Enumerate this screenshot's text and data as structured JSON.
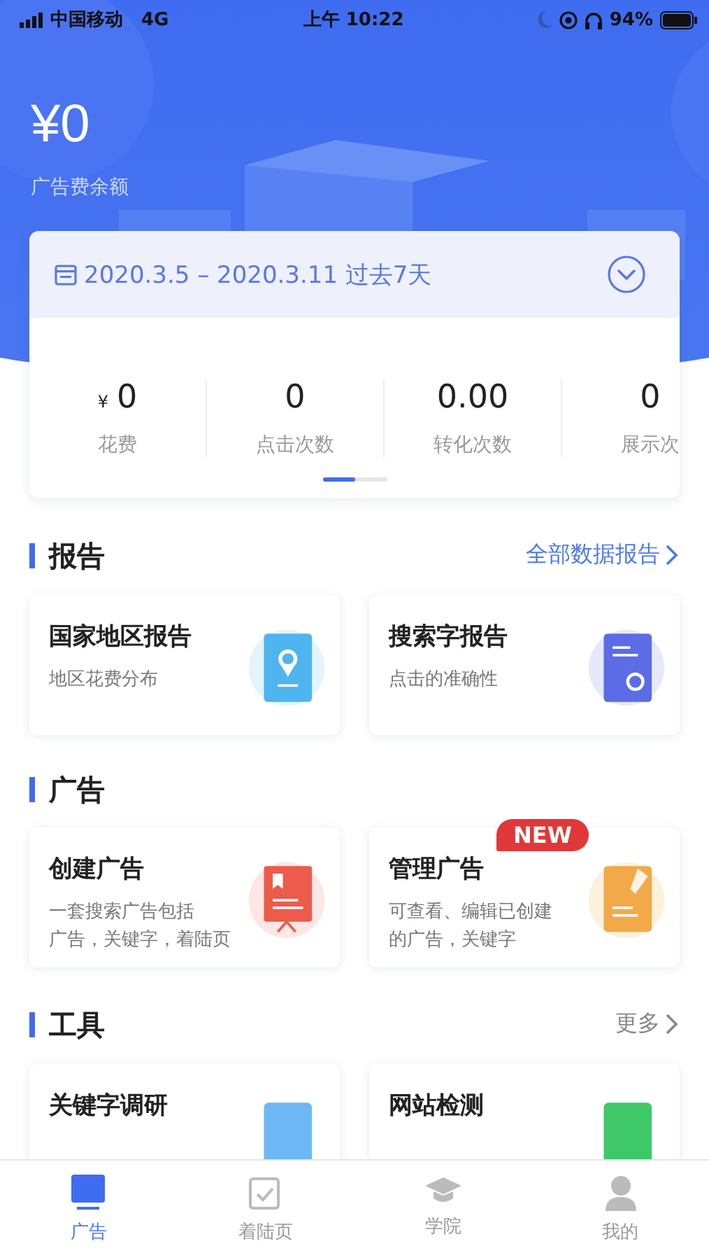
{
  "status_bar": {
    "carrier": "中国移动",
    "network": "4G",
    "time": "上午 10:22",
    "battery": "94%"
  },
  "balance": {
    "amount": "¥0",
    "label": "广告费余额"
  },
  "date_range": {
    "text": "2020.3.5 – 2020.3.11 过去7天"
  },
  "stats": [
    {
      "prefix": "¥",
      "value": "0",
      "label": "花费"
    },
    {
      "value": "0",
      "label": "点击次数"
    },
    {
      "value": "0.00",
      "label": "转化次数"
    },
    {
      "value": "0",
      "label": "展示次"
    }
  ],
  "sections": [
    {
      "title": "报告",
      "link": "全部数据报告",
      "cards": [
        {
          "title": "国家地区报告",
          "desc": [
            "地区花费分布"
          ],
          "new": false
        },
        {
          "title": "搜索字报告",
          "desc": [
            "点击的准确性"
          ],
          "new": false
        }
      ]
    },
    {
      "title": "广告",
      "cards": [
        {
          "title": "创建广告",
          "desc": [
            "一套搜索广告包括",
            "广告，关键字，着陆页"
          ],
          "new": false
        },
        {
          "title": "管理广告",
          "desc": [
            "可查看、编辑已创建",
            "的广告，关键字"
          ],
          "new": true,
          "badge": "NEW"
        }
      ]
    },
    {
      "title": "工具",
      "link": "更多",
      "cards": [
        {
          "title": "关键字调研",
          "new": false
        },
        {
          "title": "网站检测",
          "new": false
        }
      ]
    }
  ],
  "tab_bar": [
    {
      "label": "广告",
      "selected": true
    },
    {
      "label": "着陆页",
      "selected": false
    },
    {
      "label": "学院",
      "selected": false
    },
    {
      "label": "我的",
      "selected": false
    }
  ]
}
